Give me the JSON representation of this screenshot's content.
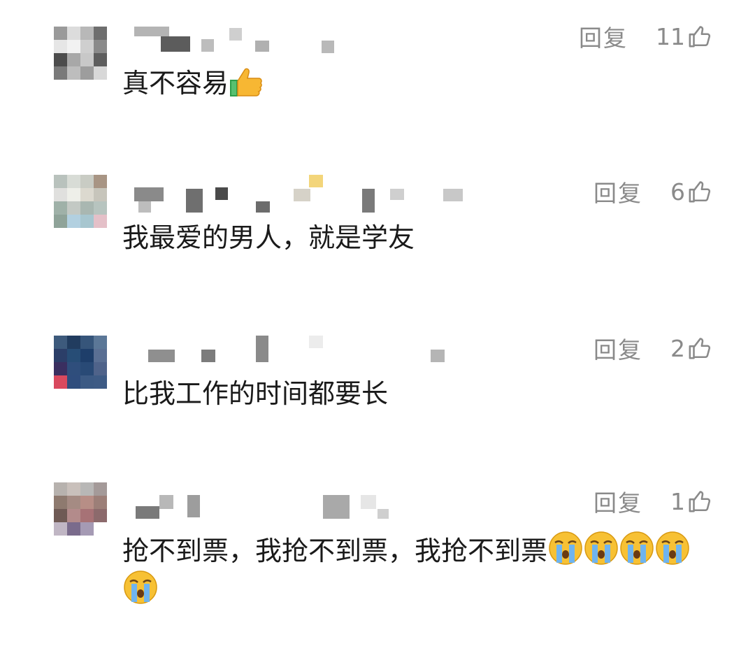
{
  "comments": [
    {
      "reply_label": "回复",
      "likes": "11",
      "text": "真不容易",
      "emojis": [
        "thumbs-up-emoji"
      ],
      "avatar_colors": [
        "#9a9a9a",
        "#dcdcdc",
        "#b8b8b8",
        "#6e6e6e",
        "#e6e6e6",
        "#f2f2f2",
        "#cfcfcf",
        "#8a8a8a",
        "#4c4c4c",
        "#a8a8a8",
        "#c8c8c8",
        "#5e5e5e",
        "#7a7a7a",
        "#bdbdbd",
        "#9d9d9d",
        "#d8d8d8"
      ]
    },
    {
      "reply_label": "回复",
      "likes": "6",
      "text": "我最爱的男人，就是学友",
      "emojis": [],
      "avatar_colors": [
        "#b9c2bd",
        "#d8dcd6",
        "#c9ccc4",
        "#a89584",
        "#e0e0de",
        "#eeefe9",
        "#dcd9cf",
        "#c7c5bb",
        "#9fb1a8",
        "#c3c9c4",
        "#a9b7b1",
        "#b7c4bf",
        "#8fa399",
        "#b2d0e0",
        "#a7c6cf",
        "#e4c0c8"
      ]
    },
    {
      "reply_label": "回复",
      "likes": "2",
      "text": "比我工作的时间都要长",
      "emojis": [],
      "avatar_colors": [
        "#3d5a7c",
        "#213c5f",
        "#36557a",
        "#5b7797",
        "#2b3e68",
        "#274d76",
        "#1e3e6a",
        "#5a6f93",
        "#3a2f60",
        "#2f4e7c",
        "#294a76",
        "#4f638a",
        "#d9495e",
        "#2f4d7d",
        "#3c5a84",
        "#3e5b85"
      ]
    },
    {
      "reply_label": "回复",
      "likes": "1",
      "text": "抢不到票，我抢不到票，我抢不到票",
      "emojis": [
        "crying-emoji",
        "crying-emoji",
        "crying-emoji",
        "crying-emoji",
        "crying-emoji"
      ],
      "avatar_colors": [
        "#b7b2ae",
        "#c9c0bb",
        "#b8b7b6",
        "#a49a99",
        "#8e7a6f",
        "#a58b83",
        "#b78e86",
        "#9c7f78",
        "#6f5a55",
        "#b38b8b",
        "#a77276",
        "#8c6a6c",
        "#c0b6c4",
        "#7a6b8c",
        "#a59ab4",
        "#ffffff"
      ]
    }
  ]
}
